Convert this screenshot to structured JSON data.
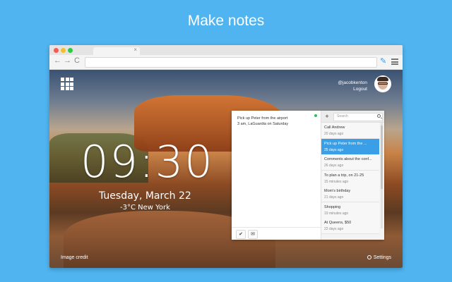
{
  "headline": "Make notes",
  "browser": {
    "tab_close": "×",
    "nav": {
      "back": "←",
      "forward": "→",
      "reload": "C"
    }
  },
  "newtab": {
    "user": {
      "handle": "@jacobkenton",
      "logout": "Logout"
    },
    "clock": "09:30",
    "date": "Tuesday, March 22",
    "weather": "-3°C  New York",
    "image_credit": "Image credit",
    "settings": "Settings"
  },
  "notes": {
    "editor_text": "Pick up Peter from the airport\n3 am, LaGuardia on Saturday",
    "search_placeholder": "Search",
    "add_label": "+",
    "confirm_label": "✔",
    "email_label": "✉",
    "items": [
      {
        "title": "Call Andrew",
        "date": "20 days ago",
        "active": false
      },
      {
        "title": "Pick up Peter from the ...",
        "date": "25 days ago",
        "active": true
      },
      {
        "title": "Comments about the conf...",
        "date": "26 days ago",
        "active": false
      },
      {
        "title": "To plan a trip, on 21-25",
        "date": "15 minutes ago",
        "active": false
      },
      {
        "title": "Mom's birthday",
        "date": "21 days ago",
        "active": false
      },
      {
        "title": "Shopping",
        "date": "19 minutes ago",
        "active": false
      },
      {
        "title": "At Queens, $50",
        "date": "22 days ago",
        "active": false
      }
    ]
  },
  "colors": {
    "background": "#4fb4f0",
    "accent": "#3a9fe6",
    "status_green": "#2ec255"
  }
}
